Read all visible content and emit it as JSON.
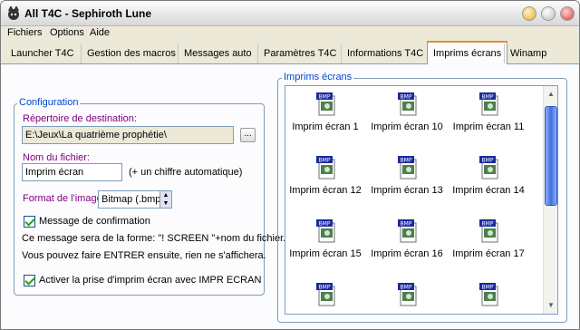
{
  "window": {
    "title": "All T4C - Sephiroth Lune"
  },
  "menu": {
    "items": [
      "Fichiers",
      "Options",
      "Aide"
    ]
  },
  "tabs": [
    "Launcher T4C",
    "Gestion des macros",
    "Messages auto",
    "Paramètres T4C",
    "Informations T4C",
    "Imprims écrans",
    "Winamp"
  ],
  "active_tab": "Imprims écrans",
  "config": {
    "group_label": "Configuration",
    "dest_label": "Répertoire de destination:",
    "dest_value": "E:\\Jeux\\La quatrième prophétie\\",
    "browse_label": "...",
    "filename_label": "Nom du fichier:",
    "filename_value": "Imprim écran",
    "filename_hint": "(+ un chiffre automatique)",
    "format_label": "Format de l'image:",
    "format_value": "Bitmap (.bmp)",
    "confirm_label": "Message de confirmation",
    "confirm_checked": true,
    "info_line1": "Ce message sera de la forme: \"! SCREEN \"+nom du fichier.",
    "info_line2": "Vous pouvez faire ENTRER ensuite, rien ne s'affichera.",
    "hotkey_label": "Activer la prise d'imprim écran avec IMPR ECRAN",
    "hotkey_checked": true
  },
  "screens": {
    "group_label": "Imprims écrans",
    "icon_badge": "BMP",
    "items": [
      "Imprim écran 1",
      "Imprim écran 10",
      "Imprim écran 11",
      "Imprim écran 12",
      "Imprim écran 13",
      "Imprim écran 14",
      "Imprim écran 15",
      "Imprim écran 16",
      "Imprim écran 17",
      "",
      "",
      ""
    ]
  },
  "colors": {
    "accent_purple": "#800080",
    "group_blue": "#0046d5",
    "tab_highlight": "#e68b2c"
  }
}
